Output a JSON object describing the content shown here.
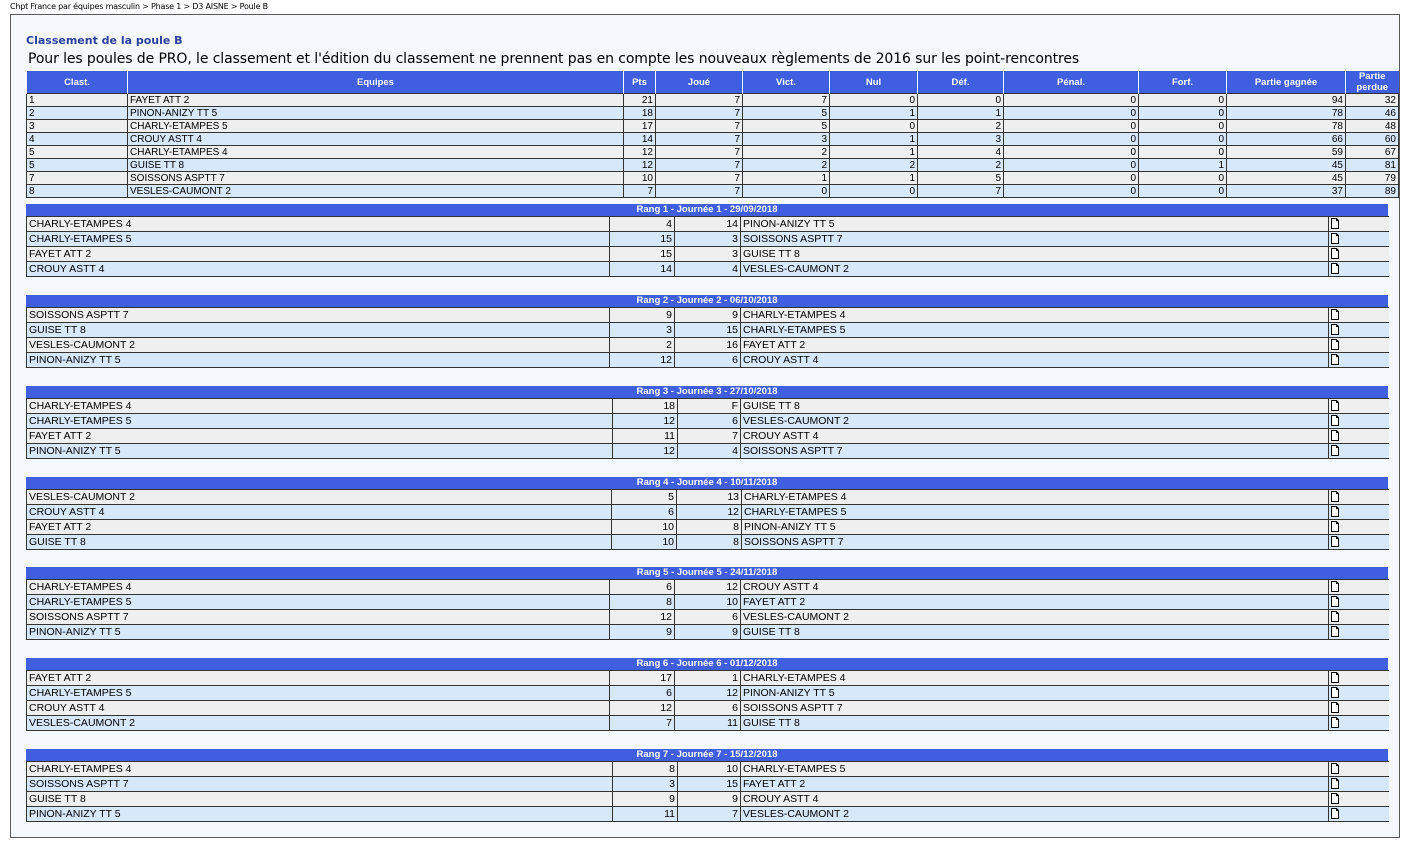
{
  "breadcrumb": "Chpt France par équipes masculin > Phase 1 > D3 AISNE > Poule B",
  "title": "Classement de la poule B",
  "note": "Pour les poules de PRO, le classement et l'édition du classement ne prennent pas en compte les nouveaux règlements de 2016 sur les point-rencontres",
  "standings": {
    "headers": [
      "Clast.",
      "Equipes",
      "Pts",
      "Joué",
      "Vict.",
      "Nul",
      "Déf.",
      "Pénal.",
      "Forf.",
      "Partie gagnée",
      "Partie perdue"
    ],
    "rows": [
      [
        "1",
        "FAYET ATT 2",
        "21",
        "7",
        "7",
        "0",
        "0",
        "0",
        "0",
        "94",
        "32"
      ],
      [
        "2",
        "PINON-ANIZY TT 5",
        "18",
        "7",
        "5",
        "1",
        "1",
        "0",
        "0",
        "78",
        "46"
      ],
      [
        "3",
        "CHARLY-ETAMPES 5",
        "17",
        "7",
        "5",
        "0",
        "2",
        "0",
        "0",
        "78",
        "48"
      ],
      [
        "4",
        "CROUY ASTT 4",
        "14",
        "7",
        "3",
        "1",
        "3",
        "0",
        "0",
        "66",
        "60"
      ],
      [
        "5",
        "CHARLY-ETAMPES 4",
        "12",
        "7",
        "2",
        "1",
        "4",
        "0",
        "0",
        "59",
        "67"
      ],
      [
        "5",
        "GUISE TT 8",
        "12",
        "7",
        "2",
        "2",
        "2",
        "0",
        "1",
        "45",
        "81"
      ],
      [
        "7",
        "SOISSONS ASPTT 7",
        "10",
        "7",
        "1",
        "1",
        "5",
        "0",
        "0",
        "45",
        "79"
      ],
      [
        "8",
        "VESLES-CAUMONT 2",
        "7",
        "7",
        "0",
        "0",
        "7",
        "0",
        "0",
        "37",
        "89"
      ]
    ]
  },
  "rounds": [
    {
      "title": "Rang 1 - Journée 1 - 29/09/2018",
      "matches": [
        [
          "CHARLY-ETAMPES 4",
          "4",
          "14",
          "PINON-ANIZY TT 5"
        ],
        [
          "CHARLY-ETAMPES 5",
          "15",
          "3",
          "SOISSONS ASPTT 7"
        ],
        [
          "FAYET ATT 2",
          "15",
          "3",
          "GUISE TT 8"
        ],
        [
          "CROUY ASTT 4",
          "14",
          "4",
          "VESLES-CAUMONT 2"
        ]
      ]
    },
    {
      "title": "Rang 2 - Journée 2 - 06/10/2018",
      "matches": [
        [
          "SOISSONS ASPTT 7",
          "9",
          "9",
          "CHARLY-ETAMPES 4"
        ],
        [
          "GUISE TT 8",
          "3",
          "15",
          "CHARLY-ETAMPES 5"
        ],
        [
          "VESLES-CAUMONT 2",
          "2",
          "16",
          "FAYET ATT 2"
        ],
        [
          "PINON-ANIZY TT 5",
          "12",
          "6",
          "CROUY ASTT 4"
        ]
      ]
    },
    {
      "title": "Rang 3 - Journée 3 - 27/10/2018",
      "matches": [
        [
          "CHARLY-ETAMPES 4",
          "18",
          "F",
          "GUISE TT 8"
        ],
        [
          "CHARLY-ETAMPES 5",
          "12",
          "6",
          "VESLES-CAUMONT 2"
        ],
        [
          "FAYET ATT 2",
          "11",
          "7",
          "CROUY ASTT 4"
        ],
        [
          "PINON-ANIZY TT 5",
          "12",
          "4",
          "SOISSONS ASPTT 7"
        ]
      ]
    },
    {
      "title": "Rang 4 - Journée 4 - 10/11/2018",
      "matches": [
        [
          "VESLES-CAUMONT 2",
          "5",
          "13",
          "CHARLY-ETAMPES 4"
        ],
        [
          "CROUY ASTT 4",
          "6",
          "12",
          "CHARLY-ETAMPES 5"
        ],
        [
          "FAYET ATT 2",
          "10",
          "8",
          "PINON-ANIZY TT 5"
        ],
        [
          "GUISE TT 8",
          "10",
          "8",
          "SOISSONS ASPTT 7"
        ]
      ]
    },
    {
      "title": "Rang 5 - Journée 5 - 24/11/2018",
      "matches": [
        [
          "CHARLY-ETAMPES 4",
          "6",
          "12",
          "CROUY ASTT 4"
        ],
        [
          "CHARLY-ETAMPES 5",
          "8",
          "10",
          "FAYET ATT 2"
        ],
        [
          "SOISSONS ASPTT 7",
          "12",
          "6",
          "VESLES-CAUMONT 2"
        ],
        [
          "PINON-ANIZY TT 5",
          "9",
          "9",
          "GUISE TT 8"
        ]
      ]
    },
    {
      "title": "Rang 6 - Journée 6 - 01/12/2018",
      "matches": [
        [
          "FAYET ATT 2",
          "17",
          "1",
          "CHARLY-ETAMPES 4"
        ],
        [
          "CHARLY-ETAMPES 5",
          "6",
          "12",
          "PINON-ANIZY TT 5"
        ],
        [
          "CROUY ASTT 4",
          "12",
          "6",
          "SOISSONS ASPTT 7"
        ],
        [
          "VESLES-CAUMONT 2",
          "7",
          "11",
          "GUISE TT 8"
        ]
      ]
    },
    {
      "title": "Rang 7 - Journée 7 - 15/12/2018",
      "matches": [
        [
          "CHARLY-ETAMPES 4",
          "8",
          "10",
          "CHARLY-ETAMPES 5"
        ],
        [
          "SOISSONS ASPTT 7",
          "3",
          "15",
          "FAYET ATT 2"
        ],
        [
          "GUISE TT 8",
          "9",
          "9",
          "CROUY ASTT 4"
        ],
        [
          "PINON-ANIZY TT 5",
          "11",
          "7",
          "VESLES-CAUMONT 2"
        ]
      ]
    }
  ],
  "icons": {
    "match_sheet": "document-icon"
  },
  "colors": {
    "header_blue": "#3f5ee0",
    "title_blue": "#2b3f9c",
    "row_gray": "#efefef",
    "row_blue": "#d8e8fb"
  }
}
